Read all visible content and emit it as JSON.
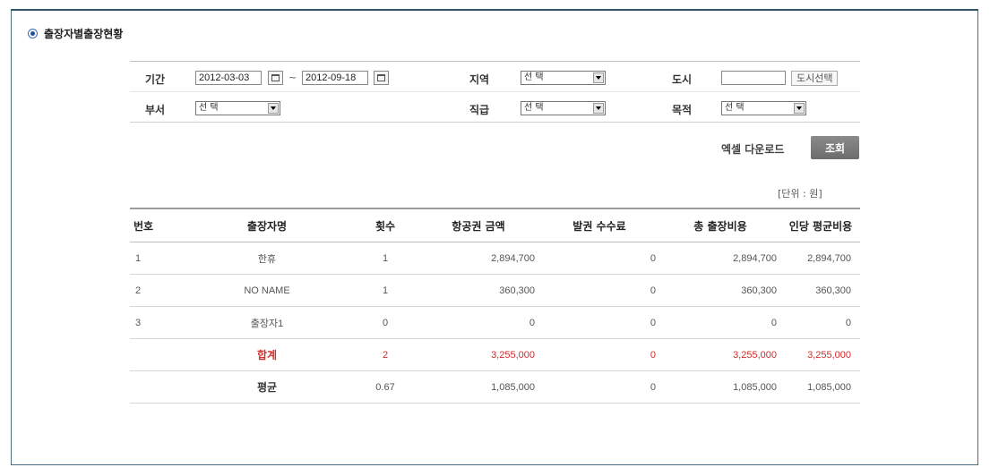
{
  "section": {
    "title": "출장자별출장현황"
  },
  "filters": {
    "period_label": "기간",
    "date_from": "2012-03-03",
    "date_sep": "~",
    "date_to": "2012-09-18",
    "region_label": "지역",
    "region_value": "선 택",
    "city_label": "도시",
    "city_value": "",
    "city_button": "도시선택",
    "dept_label": "부서",
    "dept_value": "선 택",
    "rank_label": "직급",
    "rank_value": "선 택",
    "purpose_label": "목적",
    "purpose_value": "선 택"
  },
  "actions": {
    "excel": "엑셀 다운로드",
    "search": "조회"
  },
  "unit": "[단위 : 원]",
  "table": {
    "headers": [
      "번호",
      "출장자명",
      "횟수",
      "항공권 금액",
      "발권 수수료",
      "총 출장비용",
      "인당 평균비용"
    ],
    "rows": [
      [
        "1",
        "한휴",
        "1",
        "2,894,700",
        "0",
        "2,894,700",
        "2,894,700"
      ],
      [
        "2",
        "NO NAME",
        "1",
        "360,300",
        "0",
        "360,300",
        "360,300"
      ],
      [
        "3",
        "출장자1",
        "0",
        "0",
        "0",
        "0",
        "0"
      ]
    ],
    "total": [
      "",
      "합계",
      "2",
      "3,255,000",
      "0",
      "3,255,000",
      "3,255,000"
    ],
    "average": [
      "",
      "평균",
      "0.67",
      "1,085,000",
      "0",
      "1,085,000",
      "1,085,000"
    ]
  },
  "colors": {
    "frame": "#4a6e80",
    "total_text": "#d02d2d",
    "search_button": "#7a7a7a"
  }
}
